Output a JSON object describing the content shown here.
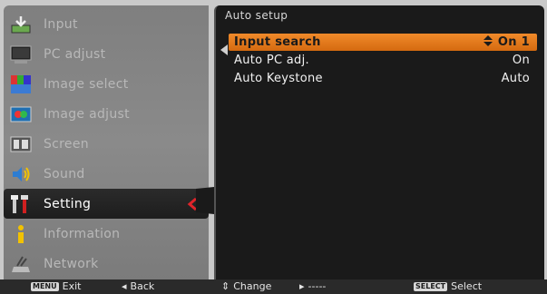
{
  "menu": {
    "items": [
      {
        "label": "Input",
        "icon": "input-icon"
      },
      {
        "label": "PC adjust",
        "icon": "pc-adjust-icon"
      },
      {
        "label": "Image select",
        "icon": "image-select-icon"
      },
      {
        "label": "Image adjust",
        "icon": "image-adjust-icon"
      },
      {
        "label": "Screen",
        "icon": "screen-icon"
      },
      {
        "label": "Sound",
        "icon": "sound-icon"
      },
      {
        "label": "Setting",
        "icon": "setting-icon"
      },
      {
        "label": "Information",
        "icon": "information-icon"
      },
      {
        "label": "Network",
        "icon": "network-icon"
      }
    ],
    "active_index": 6
  },
  "panel": {
    "title": "Auto setup",
    "rows": [
      {
        "name": "Input search",
        "value": "On 1",
        "selected": true
      },
      {
        "name": "Auto PC adj.",
        "value": "On",
        "selected": false
      },
      {
        "name": "Auto Keystone",
        "value": "Auto",
        "selected": false
      }
    ]
  },
  "footer": {
    "exit_key": "MENU",
    "exit_label": "Exit",
    "back_label": "Back",
    "change_label": "Change",
    "next_label": "-----",
    "select_key": "SELECT",
    "select_label": "Select"
  },
  "colors": {
    "highlight": "#e07a1c",
    "active_arrow": "#e0242a",
    "panel_bg": "#1a1a1a",
    "menu_bg": "#828282"
  }
}
